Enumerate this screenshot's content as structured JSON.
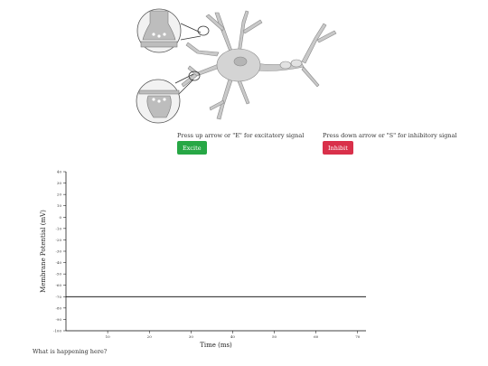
{
  "controls": {
    "excite": {
      "hint": "Press up arrow or \"E\" for excitatory signal",
      "label": "Excite",
      "color": "#27a745"
    },
    "inhibit": {
      "hint": "Press down arrow or \"S\" for inhibitory signal",
      "label": "Inhibit",
      "color": "#d9304a"
    }
  },
  "question": "What is happening here?",
  "chart_data": {
    "type": "line",
    "xlabel": "Time (ms)",
    "ylabel": "Membrane Potential (mV)",
    "xlim": [
      0,
      72
    ],
    "ylim": [
      -100,
      40
    ],
    "x_ticks": [
      10,
      20,
      30,
      40,
      50,
      60,
      70
    ],
    "y_ticks": [
      40,
      30,
      20,
      10,
      0,
      -10,
      -20,
      -30,
      -40,
      -50,
      -60,
      -70,
      -80,
      -90,
      -100
    ],
    "series": [
      {
        "x": [
          0,
          72
        ],
        "values": [
          -70,
          -70
        ]
      }
    ],
    "grid": false,
    "colors": {
      "line": "#000000",
      "axis": "#000000"
    }
  }
}
